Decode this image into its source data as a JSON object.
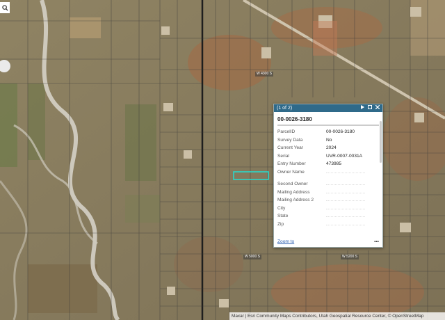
{
  "map": {
    "road_labels": [
      "W 4300 S",
      "W 5000 S",
      "W 5200 S"
    ],
    "attribution": "Maxar | Esri Community Maps Contributors, Utah Geospatial Resource Center, © OpenStreetMap"
  },
  "controls": {
    "search_icon": "search-icon"
  },
  "popup": {
    "count": "(1 of 2)",
    "next_icon": "play-icon",
    "dock_icon": "dock-icon",
    "close_icon": "close-icon",
    "title": "00-0026-3180",
    "rows": [
      {
        "k": "ParcelID",
        "v": "00-0026-3180"
      },
      {
        "k": "Survey Data",
        "v": "No"
      },
      {
        "k": "Current Year",
        "v": "2024"
      },
      {
        "k": "Serial",
        "v": "UVR-0007-0031A"
      },
      {
        "k": "Entry Number",
        "v": "473985"
      },
      {
        "k": "Owner Name",
        "v": ""
      },
      {
        "k": "Second Owner",
        "v": ""
      },
      {
        "k": "Mailing Address",
        "v": ""
      },
      {
        "k": "Mailing Address 2",
        "v": ""
      },
      {
        "k": "City",
        "v": ""
      },
      {
        "k": "State",
        "v": ""
      },
      {
        "k": "Zip",
        "v": ""
      }
    ],
    "zoom_label": "Zoom to",
    "more_label": "•••",
    "highlight_color": "#2bd6c9"
  }
}
